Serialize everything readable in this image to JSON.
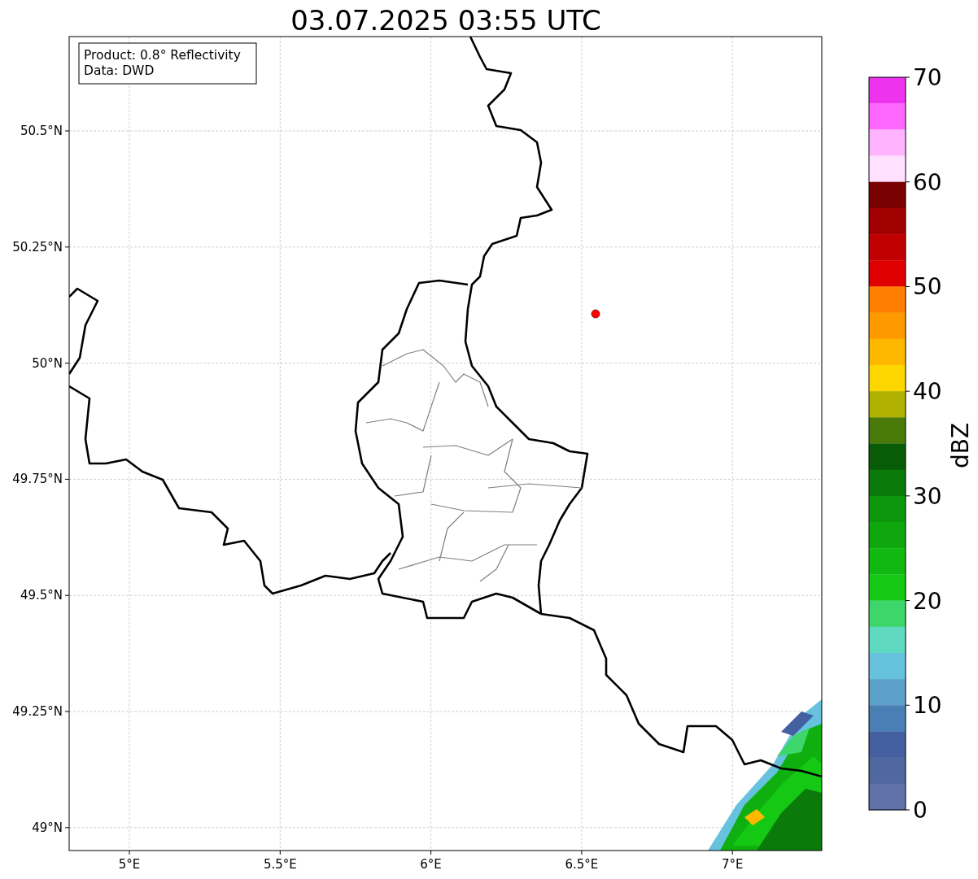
{
  "title": "03.07.2025 03:55 UTC",
  "info_box": [
    "Product: 0.8° Reflectivity",
    "Data: DWD"
  ],
  "y_ticks": [
    "50.5°N",
    "50.25°N",
    "50°N",
    "49.75°N",
    "49.5°N",
    "49.25°N",
    "49°N"
  ],
  "x_ticks": [
    "5°E",
    "5.5°E",
    "6°E",
    "6.5°E",
    "7°E"
  ],
  "colorbar": {
    "label": "dBZ",
    "ticks": [
      "70",
      "60",
      "50",
      "40",
      "30",
      "20",
      "10",
      "0"
    ],
    "segments": [
      {
        "color": "#ee33ee"
      },
      {
        "color": "#ff66ff"
      },
      {
        "color": "#ffb3ff"
      },
      {
        "color": "#ffe0ff"
      },
      {
        "color": "#780000"
      },
      {
        "color": "#a00000"
      },
      {
        "color": "#c00000"
      },
      {
        "color": "#e00000"
      },
      {
        "color": "#ff7f00"
      },
      {
        "color": "#ff9900"
      },
      {
        "color": "#ffb800"
      },
      {
        "color": "#ffd700"
      },
      {
        "color": "#b0b000"
      },
      {
        "color": "#4a7a0a"
      },
      {
        "color": "#085c08"
      },
      {
        "color": "#0a7a0a"
      },
      {
        "color": "#0c960c"
      },
      {
        "color": "#0ea80e"
      },
      {
        "color": "#10b810"
      },
      {
        "color": "#14c814"
      },
      {
        "color": "#3dd66b"
      },
      {
        "color": "#5fd9c0"
      },
      {
        "color": "#66c2dd"
      },
      {
        "color": "#5aa0c8"
      },
      {
        "color": "#4a7fb5"
      },
      {
        "color": "#4460a0"
      },
      {
        "color": "#5068a0"
      },
      {
        "color": "#6070a8"
      }
    ]
  }
}
